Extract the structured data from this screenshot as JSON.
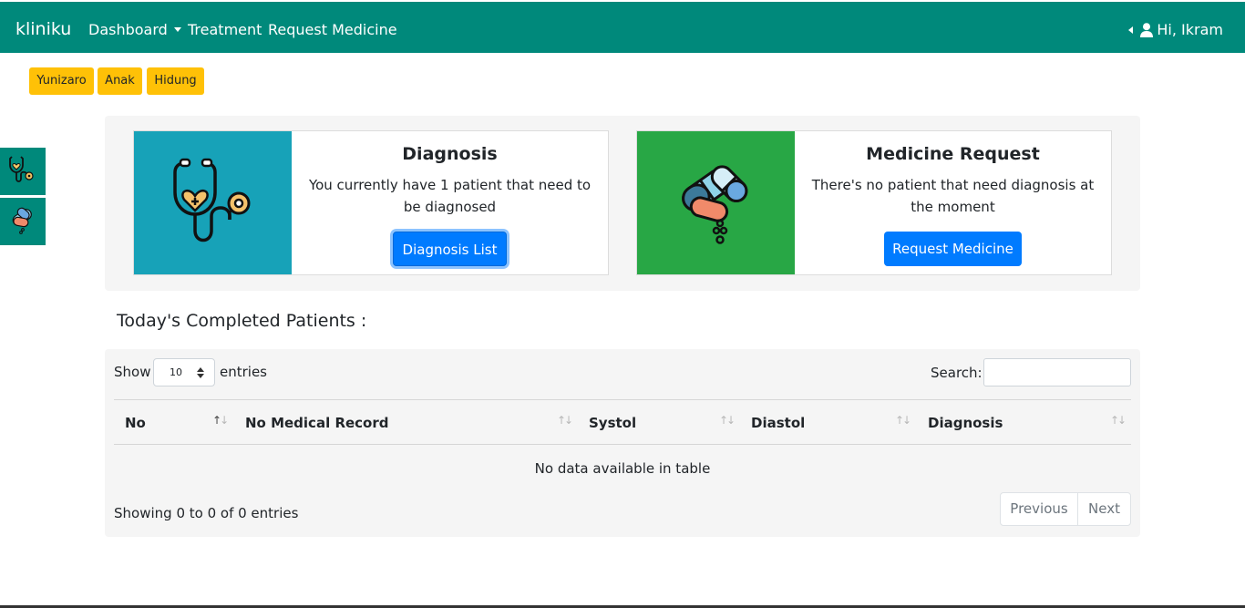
{
  "navbar": {
    "brand": "kliniku",
    "links": [
      {
        "label": "Dashboard"
      },
      {
        "label": "Treatment"
      },
      {
        "label": "Request Medicine"
      }
    ],
    "user_greeting": "Hi, Ikram",
    "color": "#00897b"
  },
  "badges": [
    "Yunizaro",
    "Anak",
    "Hidung"
  ],
  "side_shortcuts": [
    {
      "icon": "stethoscope-icon"
    },
    {
      "icon": "pills-icon"
    }
  ],
  "cards": {
    "diagnosis": {
      "title": "Diagnosis",
      "text": "You currently have 1 patient that need to be diagnosed",
      "button": "Diagnosis List",
      "image_color": "#17a2b8",
      "icon": "stethoscope-icon"
    },
    "medicine": {
      "title": "Medicine Request",
      "text": "There's no patient that need diagnosis at the moment",
      "button": "Request Medicine",
      "image_color": "#28a745",
      "icon": "pills-icon"
    }
  },
  "section_title": "Today's Completed Patients :",
  "table": {
    "show_label": "Show",
    "page_size": "10",
    "entries_label": "entries",
    "search_label": "Search:",
    "search_value": "",
    "columns": [
      "No",
      "No Medical Record",
      "Systol",
      "Diastol",
      "Diagnosis"
    ],
    "empty_message": "No data available in table",
    "info": "Showing 0 to 0 of 0 entries",
    "prev_label": "Previous",
    "next_label": "Next"
  }
}
